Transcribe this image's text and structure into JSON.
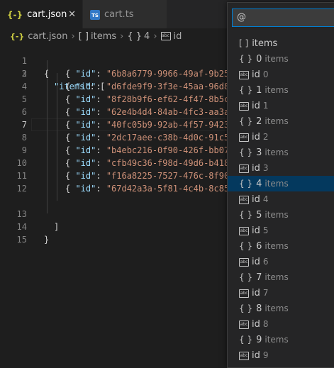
{
  "tabs": [
    {
      "label": "cart.json",
      "icon": "{-}",
      "active": true
    },
    {
      "label": "cart.ts",
      "icon": "TS",
      "active": false
    }
  ],
  "breadcrumb": {
    "file": "cart.json",
    "items": "items",
    "index": "4",
    "leaf": "id"
  },
  "editor": {
    "lines": [
      {
        "n": "1",
        "text": "{"
      },
      {
        "n": "2",
        "text": "\"items\": ["
      },
      {
        "n": "3",
        "id": "\"6b8a6779-9966-49af-9b25"
      },
      {
        "n": "4",
        "id": "\"d6fde9f9-3f3e-45aa-96d8"
      },
      {
        "n": "5",
        "id": "\"8f28b9f6-ef62-4f47-8b5c"
      },
      {
        "n": "6",
        "id": "\"62e4b4d4-84ab-4fc3-aa3a"
      },
      {
        "n": "7",
        "id": "\"40fc05b9-92ab-4f57-9423"
      },
      {
        "n": "8",
        "id": "\"2dc17aee-c38b-4d0c-91c5"
      },
      {
        "n": "9",
        "id": "\"b4ebc216-0f90-426f-bb07"
      },
      {
        "n": "10",
        "id": "\"cfb49c36-f98d-49d6-b418"
      },
      {
        "n": "11",
        "id": "\"f16a8225-7527-476c-8f90"
      },
      {
        "n": "12",
        "id": "\"67d42a3a-5f81-4c4b-8c85"
      },
      {
        "n": "13",
        "text": "]"
      },
      {
        "n": "14",
        "text": "}"
      },
      {
        "n": "15",
        "text": ""
      }
    ],
    "id_key": "\"id\"",
    "current_line": "7"
  },
  "quickpick": {
    "query": "@",
    "items": [
      {
        "icon": "[ ]",
        "label": "items",
        "desc": ""
      },
      {
        "icon": "{ }",
        "label": "0",
        "desc": "items"
      },
      {
        "icon": "abc",
        "label": "id",
        "desc": "0"
      },
      {
        "icon": "{ }",
        "label": "1",
        "desc": "items"
      },
      {
        "icon": "abc",
        "label": "id",
        "desc": "1"
      },
      {
        "icon": "{ }",
        "label": "2",
        "desc": "items"
      },
      {
        "icon": "abc",
        "label": "id",
        "desc": "2"
      },
      {
        "icon": "{ }",
        "label": "3",
        "desc": "items"
      },
      {
        "icon": "abc",
        "label": "id",
        "desc": "3"
      },
      {
        "icon": "{ }",
        "label": "4",
        "desc": "items",
        "selected": true
      },
      {
        "icon": "abc",
        "label": "id",
        "desc": "4"
      },
      {
        "icon": "{ }",
        "label": "5",
        "desc": "items"
      },
      {
        "icon": "abc",
        "label": "id",
        "desc": "5"
      },
      {
        "icon": "{ }",
        "label": "6",
        "desc": "items"
      },
      {
        "icon": "abc",
        "label": "id",
        "desc": "6"
      },
      {
        "icon": "{ }",
        "label": "7",
        "desc": "items"
      },
      {
        "icon": "abc",
        "label": "id",
        "desc": "7"
      },
      {
        "icon": "{ }",
        "label": "8",
        "desc": "items"
      },
      {
        "icon": "abc",
        "label": "id",
        "desc": "8"
      },
      {
        "icon": "{ }",
        "label": "9",
        "desc": "items"
      },
      {
        "icon": "abc",
        "label": "id",
        "desc": "9"
      }
    ]
  },
  "colors": {
    "accent": "#007fd4",
    "selection": "#04395e",
    "string": "#ce9178",
    "key": "#9cdcfe"
  }
}
